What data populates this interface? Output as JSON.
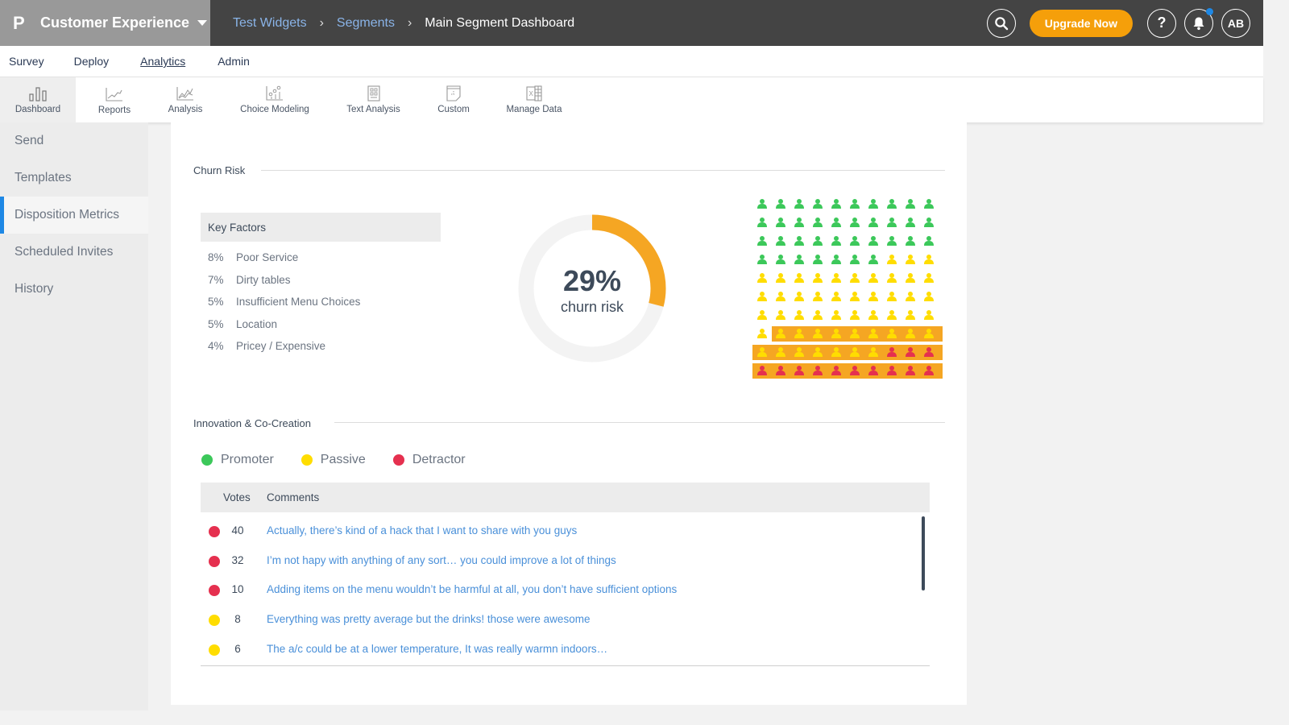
{
  "app": {
    "brand_name": "Customer Experience",
    "brand_logo": "P"
  },
  "breadcrumb": [
    {
      "label": "Test Widgets"
    },
    {
      "label": "Segments"
    },
    {
      "label": "Main Segment Dashboard"
    }
  ],
  "topbar": {
    "search_icon": "search-icon",
    "upgrade_label": "Upgrade Now",
    "help_label": "?",
    "avatar_initials": "AB",
    "notification_badge": true
  },
  "module_nav": [
    {
      "label": "Survey",
      "active": false
    },
    {
      "label": "Deploy",
      "active": false
    },
    {
      "label": "Analytics",
      "active": true
    },
    {
      "label": "Admin",
      "active": false
    }
  ],
  "tools": [
    {
      "label": "Dashboard",
      "icon": "bar-chart-icon",
      "active": true
    },
    {
      "label": "Reports",
      "icon": "line-chart-icon",
      "active": false
    },
    {
      "label": "Analysis",
      "icon": "multi-line-chart-icon",
      "active": false
    },
    {
      "label": "Choice Modeling",
      "icon": "scatter-chart-icon",
      "active": false
    },
    {
      "label": "Text Analysis",
      "icon": "document-grid-icon",
      "active": false
    },
    {
      "label": "Custom",
      "icon": "custom-sheet-icon",
      "active": false
    },
    {
      "label": "Manage Data",
      "icon": "excel-icon",
      "active": false
    }
  ],
  "sidebar": {
    "items": [
      {
        "label": "Send",
        "active": false
      },
      {
        "label": "Templates",
        "active": false
      },
      {
        "label": "Disposition Metrics",
        "active": true
      },
      {
        "label": "Scheduled Invites",
        "active": false
      },
      {
        "label": "History",
        "active": false
      }
    ]
  },
  "churn": {
    "title": "Churn Risk",
    "key_factors_title": "Key Factors",
    "key_factors": [
      {
        "pct": "8%",
        "label": "Poor Service"
      },
      {
        "pct": "7%",
        "label": "Dirty tables"
      },
      {
        "pct": "5%",
        "label": "Insufficient Menu Choices"
      },
      {
        "pct": "5%",
        "label": "Location"
      },
      {
        "pct": "4%",
        "label": "Pricey / Expensive"
      }
    ],
    "gauge_value_text": "29%",
    "gauge_fraction": 0.29,
    "gauge_label": "churn risk",
    "people": {
      "total": 100,
      "promoters": 37,
      "passives": 50,
      "detractors": 13,
      "at_risk_highlighted": 29
    }
  },
  "innovation": {
    "title": "Innovation & Co-Creation",
    "legend": [
      {
        "label": "Promoter",
        "color": "#3cc85a"
      },
      {
        "label": "Passive",
        "color": "#ffdd00"
      },
      {
        "label": "Detractor",
        "color": "#e5304f"
      }
    ],
    "columns": {
      "votes": "Votes",
      "comments": "Comments"
    },
    "rows": [
      {
        "type": "Detractor",
        "color": "#e5304f",
        "votes": "40",
        "comment": "Actually, there’s kind of a hack that I want to share with you guys"
      },
      {
        "type": "Detractor",
        "color": "#e5304f",
        "votes": "32",
        "comment": "I’m not hapy with anything of any sort… you could improve a lot of things"
      },
      {
        "type": "Detractor",
        "color": "#e5304f",
        "votes": "10",
        "comment": "Adding items on the menu wouldn’t be harmful at all, you don’t have sufficient options"
      },
      {
        "type": "Passive",
        "color": "#ffdd00",
        "votes": "8",
        "comment": "Everything was pretty average but the drinks! those were awesome"
      },
      {
        "type": "Passive",
        "color": "#ffdd00",
        "votes": "6",
        "comment": "The a/c could be at a lower temperature, It was really warmn indoors…"
      }
    ]
  },
  "colors": {
    "accent": "#f59f0a",
    "highlight": "#f5a623",
    "promoter": "#3cc85a",
    "passive": "#ffdd00",
    "detractor": "#e5304f",
    "link": "#4a90d9",
    "active_marker": "#1e88e5"
  }
}
